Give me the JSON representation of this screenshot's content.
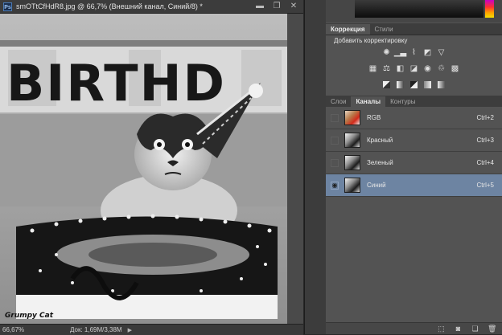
{
  "document": {
    "badge": "Ps",
    "title": "smOTtCfHdR8.jpg @ 66,7% (Внешний канал, Синий/8) *",
    "window_buttons": {
      "minimize": "▬",
      "restore": "❐",
      "close": "✕"
    },
    "photo_caption": "Grumpy Cat",
    "photo_sign": "BIRTHD",
    "status": {
      "zoom": "66,67%",
      "doc_info": "Док: 1,69M/3,38M",
      "arrow": "▶"
    }
  },
  "adjustments_panel": {
    "tabs": [
      "Коррекция",
      "Стили"
    ],
    "title": "Добавить корректировку",
    "row1_icons": [
      "brightness-icon",
      "levels-icon",
      "curves-icon",
      "exposure-icon",
      "gradient-triangle-icon"
    ],
    "row2_icons": [
      "vibrance-icon",
      "balance-icon",
      "color-balance-icon",
      "black-white-icon",
      "photo-filter-icon",
      "channel-mixer-icon",
      "color-lookup-icon"
    ],
    "row3_icons": [
      "invert-icon",
      "posterize-icon",
      "threshold-icon",
      "selective-color-icon",
      "gradient-map-icon"
    ]
  },
  "channels_panel": {
    "tabs": [
      "Слои",
      "Каналы",
      "Контуры"
    ],
    "active_tab": "Каналы",
    "channels": [
      {
        "name": "RGB",
        "shortcut": "Ctrl+2",
        "visible": false,
        "selected": false,
        "thumb": "rgb"
      },
      {
        "name": "Красный",
        "shortcut": "Ctrl+3",
        "visible": false,
        "selected": false,
        "thumb": "gray"
      },
      {
        "name": "Зеленый",
        "shortcut": "Ctrl+4",
        "visible": false,
        "selected": false,
        "thumb": "gray"
      },
      {
        "name": "Синий",
        "shortcut": "Ctrl+5",
        "visible": true,
        "selected": true,
        "thumb": "gray"
      }
    ],
    "footer_icons": [
      "load-selection-icon",
      "save-selection-icon",
      "new-channel-icon",
      "delete-channel-icon"
    ]
  },
  "colors": {
    "accent_selected_row": "#6d84a2",
    "panel_bg": "#535353"
  }
}
